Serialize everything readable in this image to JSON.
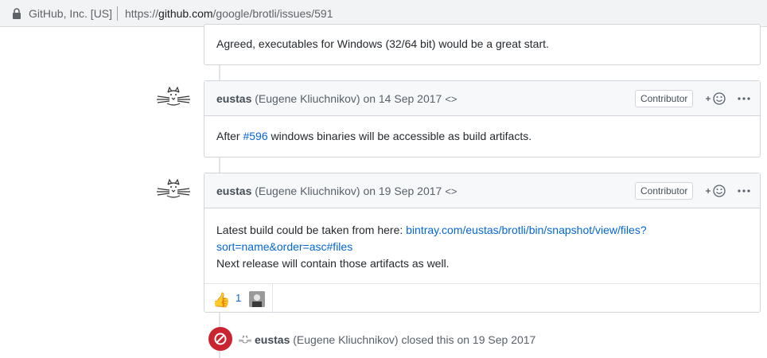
{
  "browser": {
    "site_identity": "GitHub, Inc. [US]",
    "url_prefix": "https://",
    "url_host": "github.com",
    "url_path": "/google/brotli/issues/591"
  },
  "comments": [
    {
      "body": "Agreed, executables for Windows (32/64 bit) would be a great start."
    },
    {
      "author": "eustas",
      "full_name": "(Eugene Kliuchnikov)",
      "date_text": "on 14 Sep 2017",
      "badge": "Contributor",
      "body_before_link": "After ",
      "link_text": "#596",
      "body_after_link": " windows binaries will be accessible as build artifacts."
    },
    {
      "author": "eustas",
      "full_name": "(Eugene Kliuchnikov)",
      "date_text": "on 19 Sep 2017",
      "badge": "Contributor",
      "body_before_link": "Latest build could be taken from here: ",
      "link_line1": "bintray.com/eustas/brotli/bin/snapshot/view/files?",
      "link_line2": "sort=name&order=asc#files",
      "body_line3": "Next release will contain those artifacts as well.",
      "reaction_count": "1",
      "reaction_emoji": "👍"
    }
  ],
  "closed_event": {
    "author": "eustas",
    "full_name": "(Eugene Kliuchnikov)",
    "action_text": "closed this on 19 Sep 2017"
  },
  "colors": {
    "link": "#0366d6",
    "closed_icon": "#cb2431",
    "header_bg": "#f6f8fa",
    "border": "#d1d5da"
  }
}
